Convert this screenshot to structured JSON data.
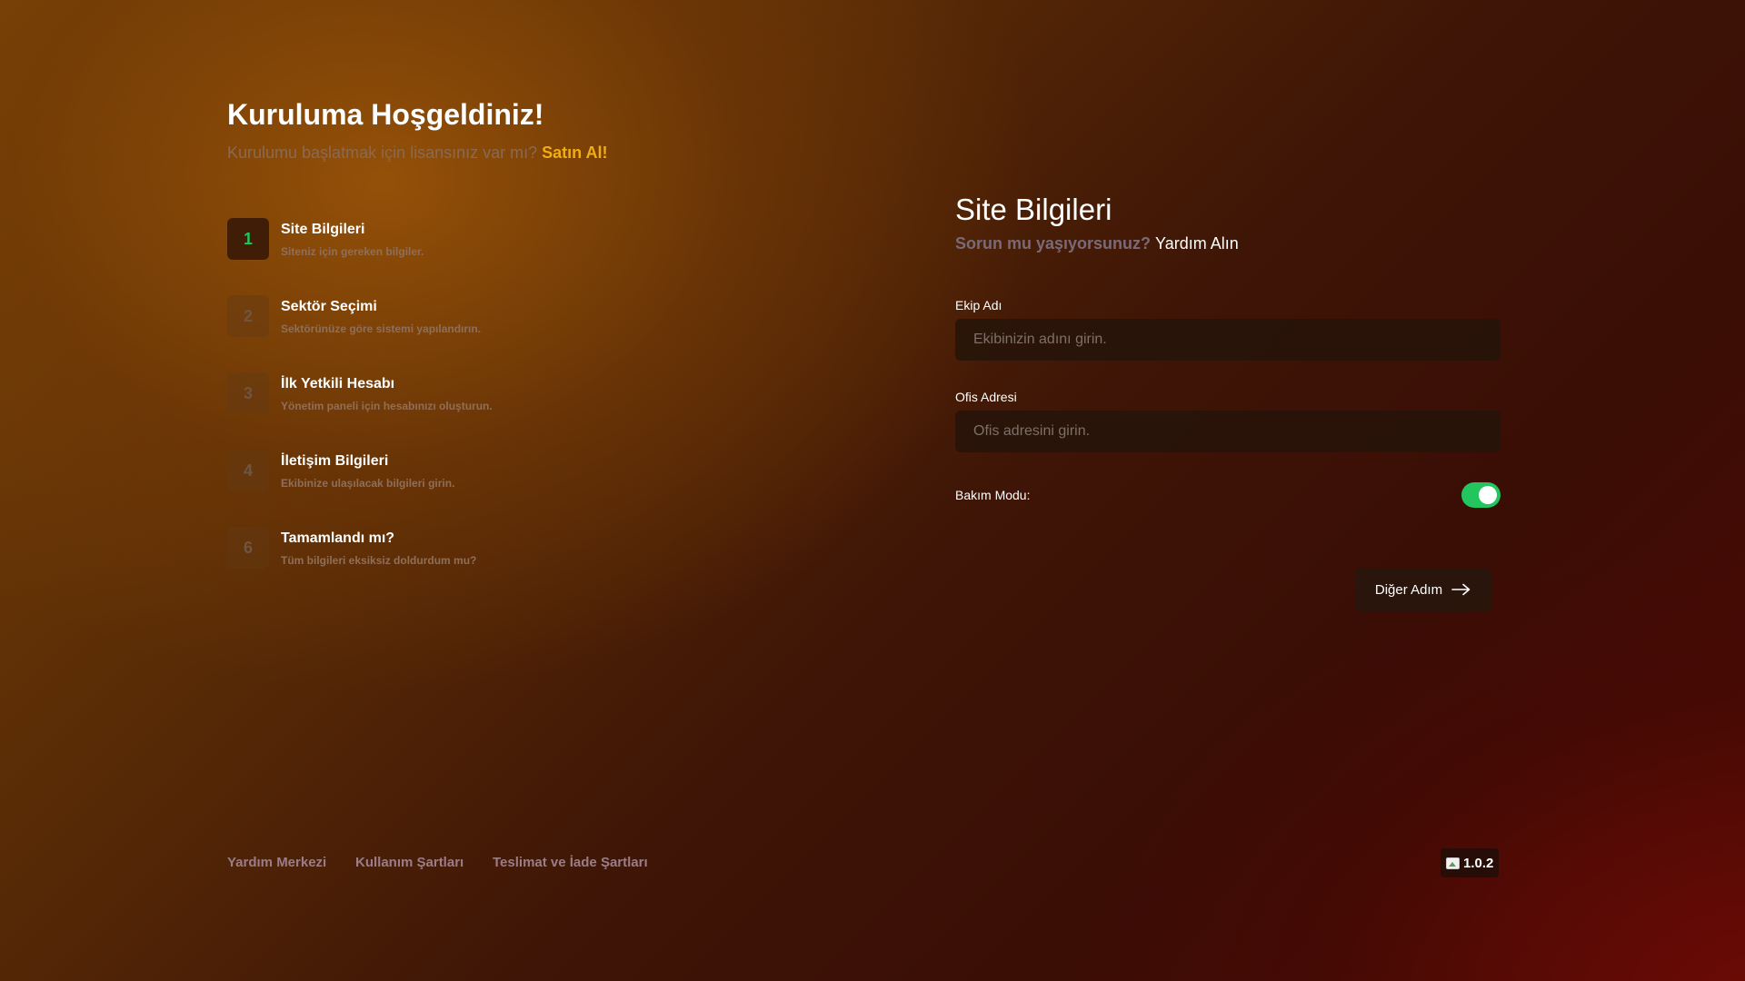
{
  "header": {
    "title": "Kuruluma Hoşgeldiniz!",
    "subtitle": "Kurulumu başlatmak için lisansınız var mı?",
    "buy_link": "Satın Al!"
  },
  "steps": [
    {
      "number": "1",
      "title": "Site Bilgileri",
      "description": "Siteniz için gereken bilgiler.",
      "active": true
    },
    {
      "number": "2",
      "title": "Sektör Seçimi",
      "description": "Sektörünüze göre sistemi yapılandırın.",
      "active": false
    },
    {
      "number": "3",
      "title": "İlk Yetkili Hesabı",
      "description": "Yönetim paneli için hesabınızı oluşturun.",
      "active": false
    },
    {
      "number": "4",
      "title": "İletişim Bilgileri",
      "description": "Ekibinize ulaşılacak bilgileri girin.",
      "active": false
    },
    {
      "number": "6",
      "title": "Tamamlandı mı?",
      "description": "Tüm bilgileri eksiksiz doldurdum mu?",
      "active": false
    }
  ],
  "panel": {
    "title": "Site Bilgileri",
    "question": "Sorun mu yaşıyorsunuz?",
    "help_link": "Yardım Alın",
    "fields": [
      {
        "label": "Ekip Adı",
        "value": "",
        "placeholder": "Ekibinizin adını girin."
      },
      {
        "label": "Ofis Adresi",
        "value": "",
        "placeholder": "Ofis adresini girin."
      }
    ],
    "maintenance": {
      "label": "Bakım Modu:",
      "enabled": true
    },
    "next_button": "Diğer Adım"
  },
  "footer": {
    "links": [
      "Yardım Merkezi",
      "Kullanım Şartları",
      "Teslimat ve İade Şartları"
    ],
    "version": "1.0.2"
  },
  "colors": {
    "accent_green": "#22c55e",
    "buy_link": "#f0ad14"
  },
  "icons": {
    "next_button": "arrow-right-icon",
    "version_badge": "broken-image-icon"
  }
}
